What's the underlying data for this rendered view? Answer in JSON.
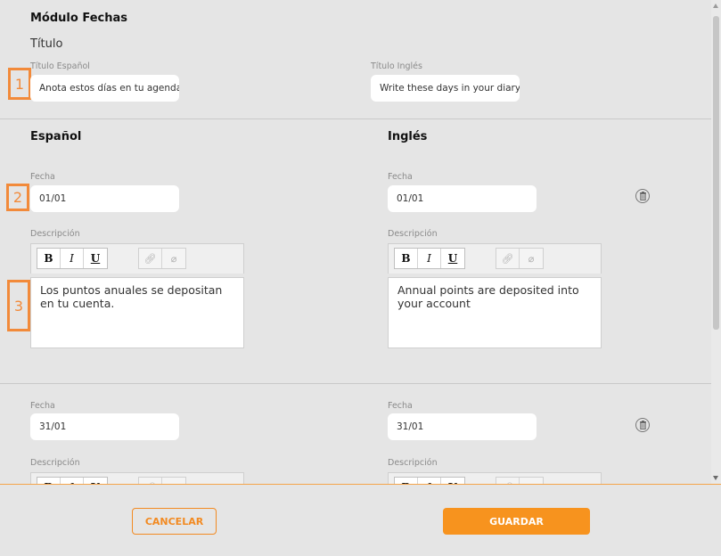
{
  "module": {
    "heading": "Módulo Fechas",
    "title_label": "Título",
    "title_es_label": "Título Español",
    "title_es_value": "Anota estos días en tu agenda",
    "title_en_label": "Título Inglés",
    "title_en_value": "Write these days in your diary"
  },
  "columns": {
    "es": "Español",
    "en": "Inglés"
  },
  "badges": [
    "1",
    "2",
    "3"
  ],
  "entries": [
    {
      "fecha_label": "Fecha",
      "fecha_es": "01/01",
      "fecha_en": "01/01",
      "desc_label": "Descripción",
      "desc_es": "Los puntos anuales se depositan en tu cuenta.",
      "desc_en": "Annual points are deposited into your account"
    },
    {
      "fecha_label": "Fecha",
      "fecha_es": "31/01",
      "fecha_en": "31/01",
      "desc_label": "Descripción"
    }
  ],
  "toolbar": {
    "bold": "B",
    "italic": "I",
    "underline": "U",
    "link_icon": "link-icon",
    "unlink_icon": "unlink-icon"
  },
  "footer": {
    "cancel_label": "CANCELAR",
    "save_label": "GUARDAR"
  },
  "colors": {
    "accent": "#f7931e",
    "badge": "#f28a3a",
    "background": "#e5e5e5"
  }
}
